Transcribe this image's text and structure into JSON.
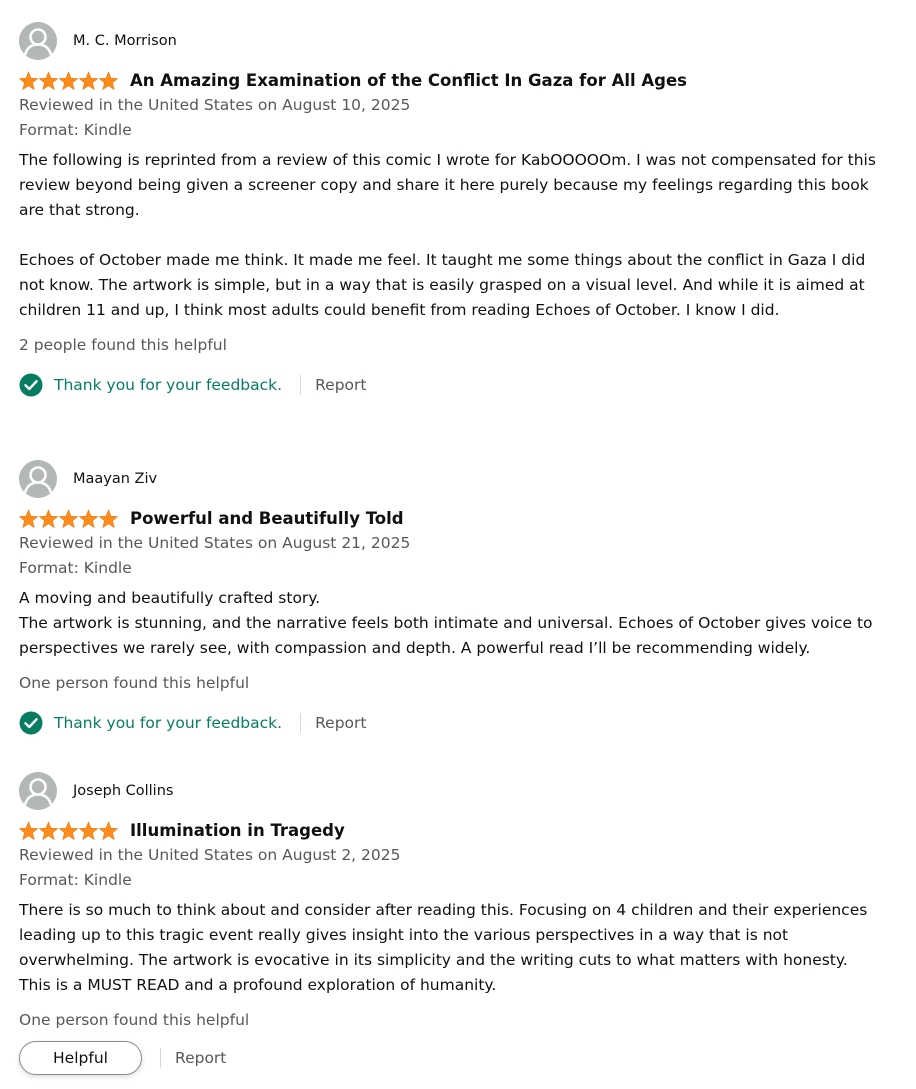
{
  "colors": {
    "star": "#ff8c1a",
    "secondary_text": "#565959",
    "feedback_green": "#067d62",
    "avatar_gray": "#b3b7b7"
  },
  "reviews": [
    {
      "name": "M. C. Morrison",
      "rating": 5,
      "title": "An Amazing Examination of the Conflict In Gaza for All Ages",
      "date": "Reviewed in the United States on August 10, 2025",
      "format": "Format: Kindle",
      "paragraphs": [
        "The following is reprinted from a review of this comic I wrote for KabOOOOOm. I was not compensated for this review beyond being given a screener copy and share it here purely because my feelings regarding this book are that strong.",
        "Echoes of October made me think. It made me feel. It taught me some things about the conflict in Gaza I did not know. The artwork is simple, but in a way that is easily grasped on a visual level. And while it is aimed at children 11 and up, I think most adults could benefit from reading Echoes of October. I know I did."
      ],
      "helpful": "2 people found this helpful",
      "feedback": "Thank you for your feedback.",
      "report": "Report"
    },
    {
      "name": "Maayan Ziv",
      "rating": 5,
      "title": "Powerful and Beautifully Told",
      "date": "Reviewed in the United States on August 21, 2025",
      "format": "Format: Kindle",
      "paragraphs": [
        "A moving and beautifully crafted story.\nThe artwork is stunning, and the narrative feels both intimate and universal. Echoes of October gives voice to perspectives we rarely see, with compassion and depth. A powerful read I’ll be recommending widely."
      ],
      "helpful": "One person found this helpful",
      "feedback": "Thank you for your feedback.",
      "report": "Report"
    },
    {
      "name": "Joseph Collins",
      "rating": 5,
      "title": "Illumination in Tragedy",
      "date": "Reviewed in the United States on August 2, 2025",
      "format": "Format: Kindle",
      "paragraphs": [
        "There is so much to think about and consider after reading this. Focusing on 4 children and their experiences leading up to this tragic event really gives insight into the various perspectives in a way that is not overwhelming. The artwork is evocative in its simplicity and the writing cuts to what matters with honesty. This is a MUST READ and a profound exploration of humanity."
      ],
      "helpful": "One person found this helpful",
      "helpful_button": "Helpful",
      "report": "Report"
    }
  ]
}
